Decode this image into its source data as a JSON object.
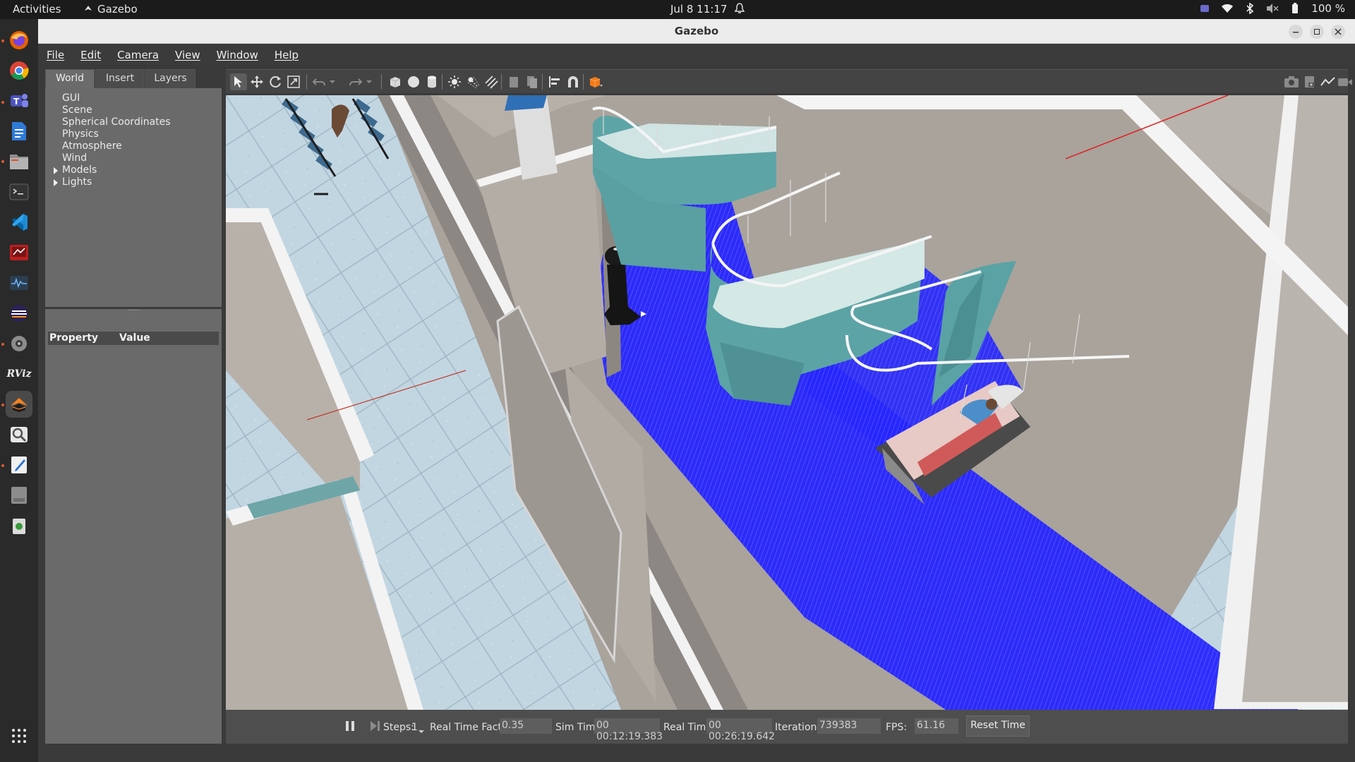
{
  "topbar": {
    "activities": "Activities",
    "app_name": "Gazebo",
    "clock": "Jul 8  11:17",
    "battery": "100 %"
  },
  "dock": {
    "items": [
      "firefox-icon",
      "chrome-icon",
      "teams-icon",
      "text-editor-icon",
      "files-icon",
      "terminal-icon",
      "vscode-icon",
      "app-red-icon",
      "system-monitor-icon",
      "eclipse-icon",
      "settings-icon",
      "rviz-icon",
      "gazebo-icon",
      "image-viewer-icon",
      "text-pad-icon",
      "ssd-icon",
      "trash-icon",
      "app-grid-icon"
    ],
    "rviz_label": "RViz"
  },
  "window": {
    "title": "Gazebo"
  },
  "menubar": {
    "items": [
      "File",
      "Edit",
      "Camera",
      "View",
      "Window",
      "Help"
    ]
  },
  "leftpanel": {
    "tabs": [
      "World",
      "Insert",
      "Layers"
    ],
    "active_tab": "World",
    "tree": [
      "GUI",
      "Scene",
      "Spherical Coordinates",
      "Physics",
      "Atmosphere",
      "Wind",
      "Models",
      "Lights"
    ],
    "property_header": "Property",
    "value_header": "Value"
  },
  "statusbar": {
    "steps_label": "Steps:",
    "steps_value": "1",
    "rtf_label": "Real Time Factor:",
    "rtf_value": "0.35",
    "sim_time_label": "Sim Time:",
    "sim_time_value": "00 00:12:19.383",
    "real_time_label": "Real Time:",
    "real_time_value": "00 00:26:19.642",
    "iterations_label": "Iterations:",
    "iterations_value": "739383",
    "fps_label": "FPS:",
    "fps_value": "61.16",
    "reset_label": "Reset Time"
  },
  "colors": {
    "laser": "#1f1fff",
    "floor": "#bcd3e0",
    "wall": "#b9b2ab",
    "curtain": "#5aa3a6"
  }
}
